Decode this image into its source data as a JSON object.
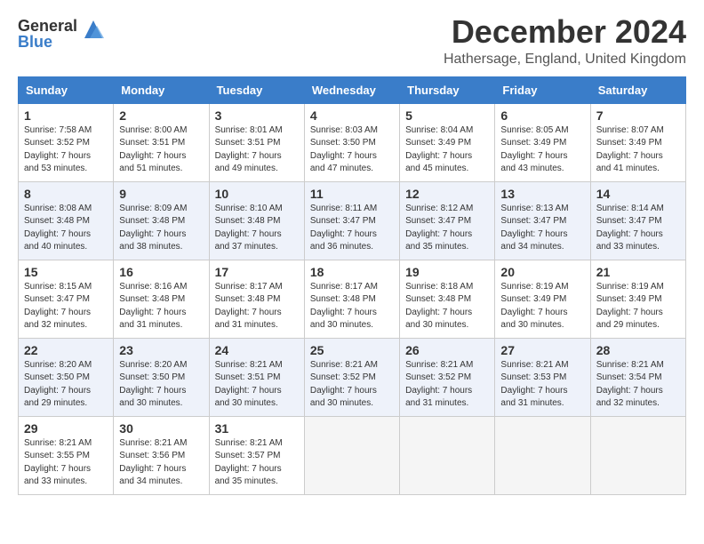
{
  "logo": {
    "general": "General",
    "blue": "Blue"
  },
  "title": "December 2024",
  "location": "Hathersage, England, United Kingdom",
  "days_of_week": [
    "Sunday",
    "Monday",
    "Tuesday",
    "Wednesday",
    "Thursday",
    "Friday",
    "Saturday"
  ],
  "weeks": [
    [
      {
        "day": 1,
        "sunrise": "7:58 AM",
        "sunset": "3:52 PM",
        "daylight": "7 hours and 53 minutes."
      },
      {
        "day": 2,
        "sunrise": "8:00 AM",
        "sunset": "3:51 PM",
        "daylight": "7 hours and 51 minutes."
      },
      {
        "day": 3,
        "sunrise": "8:01 AM",
        "sunset": "3:51 PM",
        "daylight": "7 hours and 49 minutes."
      },
      {
        "day": 4,
        "sunrise": "8:03 AM",
        "sunset": "3:50 PM",
        "daylight": "7 hours and 47 minutes."
      },
      {
        "day": 5,
        "sunrise": "8:04 AM",
        "sunset": "3:49 PM",
        "daylight": "7 hours and 45 minutes."
      },
      {
        "day": 6,
        "sunrise": "8:05 AM",
        "sunset": "3:49 PM",
        "daylight": "7 hours and 43 minutes."
      },
      {
        "day": 7,
        "sunrise": "8:07 AM",
        "sunset": "3:49 PM",
        "daylight": "7 hours and 41 minutes."
      }
    ],
    [
      {
        "day": 8,
        "sunrise": "8:08 AM",
        "sunset": "3:48 PM",
        "daylight": "7 hours and 40 minutes."
      },
      {
        "day": 9,
        "sunrise": "8:09 AM",
        "sunset": "3:48 PM",
        "daylight": "7 hours and 38 minutes."
      },
      {
        "day": 10,
        "sunrise": "8:10 AM",
        "sunset": "3:48 PM",
        "daylight": "7 hours and 37 minutes."
      },
      {
        "day": 11,
        "sunrise": "8:11 AM",
        "sunset": "3:47 PM",
        "daylight": "7 hours and 36 minutes."
      },
      {
        "day": 12,
        "sunrise": "8:12 AM",
        "sunset": "3:47 PM",
        "daylight": "7 hours and 35 minutes."
      },
      {
        "day": 13,
        "sunrise": "8:13 AM",
        "sunset": "3:47 PM",
        "daylight": "7 hours and 34 minutes."
      },
      {
        "day": 14,
        "sunrise": "8:14 AM",
        "sunset": "3:47 PM",
        "daylight": "7 hours and 33 minutes."
      }
    ],
    [
      {
        "day": 15,
        "sunrise": "8:15 AM",
        "sunset": "3:47 PM",
        "daylight": "7 hours and 32 minutes."
      },
      {
        "day": 16,
        "sunrise": "8:16 AM",
        "sunset": "3:48 PM",
        "daylight": "7 hours and 31 minutes."
      },
      {
        "day": 17,
        "sunrise": "8:17 AM",
        "sunset": "3:48 PM",
        "daylight": "7 hours and 31 minutes."
      },
      {
        "day": 18,
        "sunrise": "8:17 AM",
        "sunset": "3:48 PM",
        "daylight": "7 hours and 30 minutes."
      },
      {
        "day": 19,
        "sunrise": "8:18 AM",
        "sunset": "3:48 PM",
        "daylight": "7 hours and 30 minutes."
      },
      {
        "day": 20,
        "sunrise": "8:19 AM",
        "sunset": "3:49 PM",
        "daylight": "7 hours and 30 minutes."
      },
      {
        "day": 21,
        "sunrise": "8:19 AM",
        "sunset": "3:49 PM",
        "daylight": "7 hours and 29 minutes."
      }
    ],
    [
      {
        "day": 22,
        "sunrise": "8:20 AM",
        "sunset": "3:50 PM",
        "daylight": "7 hours and 29 minutes."
      },
      {
        "day": 23,
        "sunrise": "8:20 AM",
        "sunset": "3:50 PM",
        "daylight": "7 hours and 30 minutes."
      },
      {
        "day": 24,
        "sunrise": "8:21 AM",
        "sunset": "3:51 PM",
        "daylight": "7 hours and 30 minutes."
      },
      {
        "day": 25,
        "sunrise": "8:21 AM",
        "sunset": "3:52 PM",
        "daylight": "7 hours and 30 minutes."
      },
      {
        "day": 26,
        "sunrise": "8:21 AM",
        "sunset": "3:52 PM",
        "daylight": "7 hours and 31 minutes."
      },
      {
        "day": 27,
        "sunrise": "8:21 AM",
        "sunset": "3:53 PM",
        "daylight": "7 hours and 31 minutes."
      },
      {
        "day": 28,
        "sunrise": "8:21 AM",
        "sunset": "3:54 PM",
        "daylight": "7 hours and 32 minutes."
      }
    ],
    [
      {
        "day": 29,
        "sunrise": "8:21 AM",
        "sunset": "3:55 PM",
        "daylight": "7 hours and 33 minutes."
      },
      {
        "day": 30,
        "sunrise": "8:21 AM",
        "sunset": "3:56 PM",
        "daylight": "7 hours and 34 minutes."
      },
      {
        "day": 31,
        "sunrise": "8:21 AM",
        "sunset": "3:57 PM",
        "daylight": "7 hours and 35 minutes."
      },
      null,
      null,
      null,
      null
    ]
  ]
}
